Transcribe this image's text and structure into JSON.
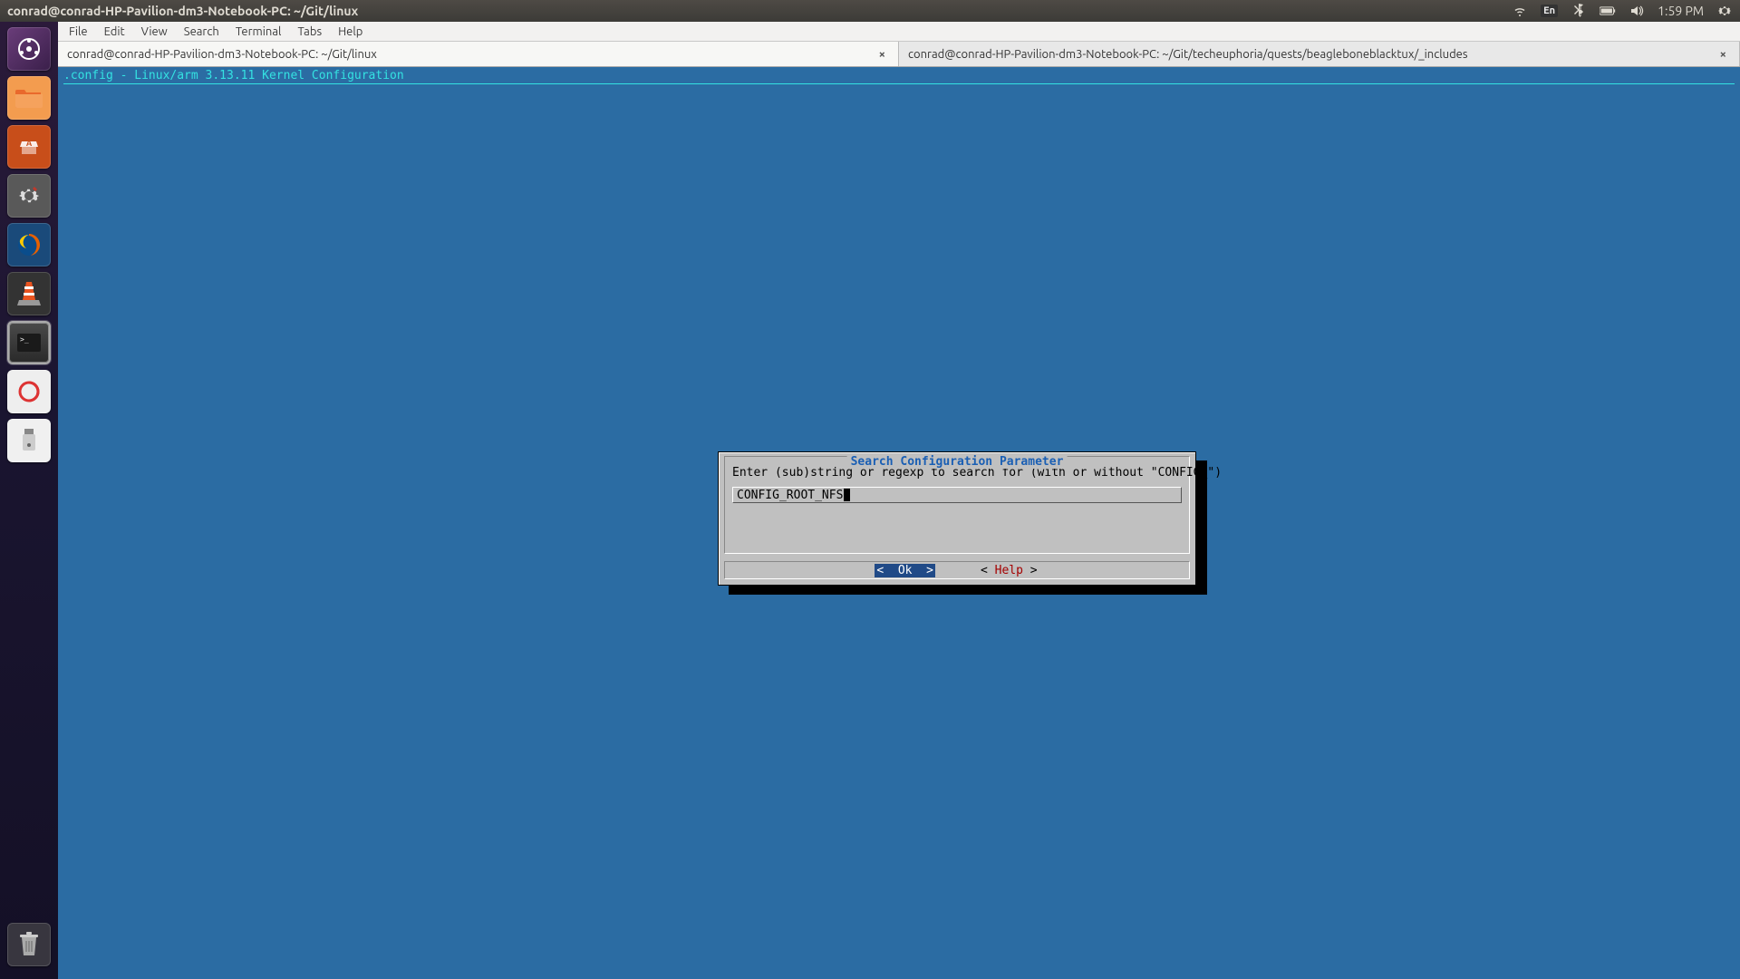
{
  "titlebar": {
    "title": "conrad@conrad-HP-Pavilion-dm3-Notebook-PC: ~/Git/linux",
    "indicators": {
      "lang": "En",
      "time": "1:59 PM"
    }
  },
  "menubar": {
    "items": [
      "File",
      "Edit",
      "View",
      "Search",
      "Terminal",
      "Tabs",
      "Help"
    ]
  },
  "tabs": [
    {
      "label": "conrad@conrad-HP-Pavilion-dm3-Notebook-PC: ~/Git/linux",
      "active": true
    },
    {
      "label": "conrad@conrad-HP-Pavilion-dm3-Notebook-PC: ~/Git/techeuphoria/quests/beagleboneblacktux/_includes",
      "active": false
    }
  ],
  "terminal": {
    "header": ".config - Linux/arm 3.13.11 Kernel Configuration"
  },
  "dialog": {
    "title": "Search Configuration Parameter",
    "prompt": "Enter (sub)string or regexp to search for (with or without \"CONFIG_\")",
    "input_value": "CONFIG_ROOT_NFS",
    "ok_label": "Ok",
    "help_label": "Help"
  },
  "launcher": {
    "items": [
      {
        "name": "dash-icon",
        "bg": "#4b2a57"
      },
      {
        "name": "files-icon",
        "bg": "#e9692c"
      },
      {
        "name": "software-center-icon",
        "bg": "#d75f00"
      },
      {
        "name": "settings-icon",
        "bg": "#5a5a5a"
      },
      {
        "name": "firefox-icon",
        "bg": "#0a84ff"
      },
      {
        "name": "vlc-icon",
        "bg": "#e95420"
      },
      {
        "name": "terminal-icon",
        "bg": "#2e2e2e"
      },
      {
        "name": "pdf-viewer-icon",
        "bg": "#d33"
      },
      {
        "name": "usb-creator-icon",
        "bg": "#e6e6e6"
      }
    ]
  }
}
